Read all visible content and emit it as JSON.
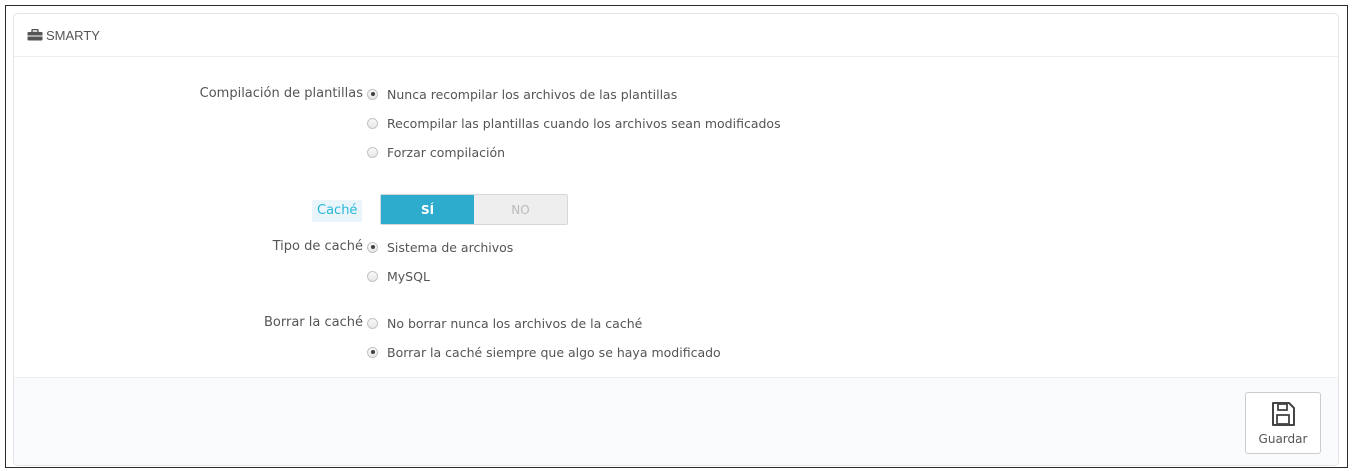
{
  "panel": {
    "title": "SMARTY",
    "icon": "briefcase-icon"
  },
  "template_compilation": {
    "label": "Compilación de plantillas",
    "options": [
      {
        "label": "Nunca recompilar los archivos de las plantillas",
        "checked": true
      },
      {
        "label": "Recompilar las plantillas cuando los archivos sean modificados",
        "checked": false
      },
      {
        "label": "Forzar compilación",
        "checked": false
      }
    ]
  },
  "cache": {
    "label": "Caché",
    "yes_label": "SÍ",
    "no_label": "NO",
    "value": "SÍ",
    "accent_color": "#2eacce"
  },
  "cache_type": {
    "label": "Tipo de caché",
    "options": [
      {
        "label": "Sistema de archivos",
        "checked": true
      },
      {
        "label": "MySQL",
        "checked": false
      }
    ]
  },
  "clear_cache": {
    "label": "Borrar la caché",
    "options": [
      {
        "label": "No borrar nunca los archivos de la caché",
        "checked": false
      },
      {
        "label": "Borrar la caché siempre que algo se haya modificado",
        "checked": true
      }
    ]
  },
  "footer": {
    "save_label": "Guardar",
    "save_icon": "floppy-disk-icon"
  }
}
